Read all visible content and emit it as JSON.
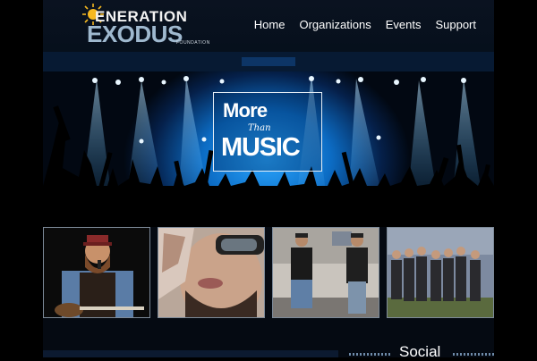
{
  "logo": {
    "line1": "ENERATION",
    "line2": "EXODUS",
    "line3": "FOUNDATION"
  },
  "nav": {
    "items": [
      "Home",
      "Organizations",
      "Events",
      "Support"
    ]
  },
  "hero": {
    "badge_top": "More",
    "badge_mid": "Than",
    "badge_bottom": "MUSIC"
  },
  "thumbnails": [
    "singer-with-guitar",
    "man-with-glasses",
    "two-performers",
    "band-group"
  ],
  "footer": {
    "social_heading": "Social"
  },
  "colors": {
    "accent": "#1e9bff",
    "background": "#000000",
    "logo_blue": "#9fb9cf"
  }
}
